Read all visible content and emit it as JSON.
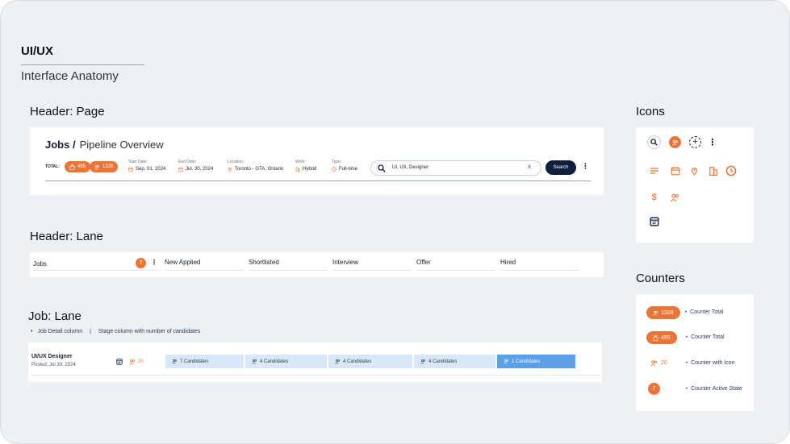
{
  "page": {
    "title": "UI/UX",
    "subtitle": "Interface Anatomy"
  },
  "sections": {
    "header_page": "Header: Page",
    "header_lane": "Header: Lane",
    "job_lane": "Job: Lane",
    "icons": "Icons",
    "counters": "Counters"
  },
  "page_header": {
    "title_bold": "Jobs /",
    "title_light": "Pipeline Overview",
    "total_label": "TOTAL:",
    "pill_jobs": "495",
    "pill_candidates": "1328",
    "start_label": "Start Date:",
    "start_value": "Sep. 01, 2024",
    "end_label": "End Date:",
    "end_value": "Jul. 30, 2024",
    "location_label": "Location:",
    "location_value": "Toronto - GTA, Ontario",
    "work_label": "Work:",
    "work_value": "Hybrid",
    "type_label": "Type:",
    "type_value": "Full-time",
    "search_value": "UI, UX, Designer",
    "search_clear": "X",
    "search_button": "Search"
  },
  "lane_header": {
    "jobs_label": "Jobs",
    "jobs_count": "7",
    "stages": [
      "New Applied",
      "Shortlisted",
      "Interview",
      "Offer",
      "Hired"
    ]
  },
  "job_lane": {
    "note_left": "Job Detail column",
    "note_sep": "|",
    "note_right": "Stage column with number of candidates",
    "job_title": "UI/UX Designer",
    "job_posted": "Posted: Jul 30, 2024",
    "job_count": "20",
    "stages": [
      "7 Candidates",
      "4 Candidates",
      "4 Candidates",
      "4 Candidates",
      "1 Candidates"
    ]
  },
  "counters": {
    "total_value": "1328",
    "total_label": "Counter Total",
    "jobs_value": "495",
    "jobs_label": "Counter Total",
    "icon_value": "20",
    "icon_label": "Counter with Icon",
    "active_value": "7",
    "active_label": "Counter Active State"
  },
  "colors": {
    "accent": "#e8763a",
    "navy": "#0f1f3d",
    "stage_bg": "#d8e8f8",
    "stage_active": "#5b9fe6"
  }
}
